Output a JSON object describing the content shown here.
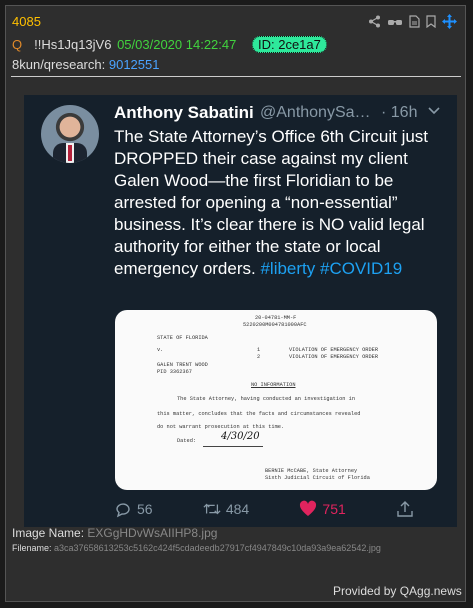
{
  "post": {
    "number": "4085",
    "tripcode_marker": "Q",
    "tripcode": "!!Hs1Jq13jV6",
    "date": "05/03/2020 14:22:47",
    "id_label": "ID: 2ce1a7",
    "board": "8kun/qresearch:",
    "board_link": "9012551"
  },
  "tweet": {
    "name": "Anthony Sabatini",
    "handle": "@AnthonySa…",
    "time": "· 16h",
    "text_main": "The State Attorney’s Office 6th Circuit just DROPPED their case against my client Galen Wood—the first Floridian to be arrested for opening a “non-essential” business.  It’s clear there is NO valid legal authority for either the state or local emergency orders.",
    "hashtag1": "#liberty",
    "hashtag2": "#COVID19",
    "replies": "56",
    "retweets": "484",
    "likes": "751"
  },
  "document": {
    "case_no": "20-04781-MM-F",
    "barcode_text": "5220200M004781000AFC",
    "state": "STATE OF FLORIDA",
    "vs": "v.",
    "count1_num": "1",
    "count1": "VIOLATION OF EMERGENCY ORDER",
    "count2_num": "2",
    "count2": "VIOLATION OF EMERGENCY ORDER",
    "defendant": "GALEN TRENT WOOD",
    "pid": "PID 3362367",
    "heading": "NO INFORMATION",
    "body1": "The State Attorney, having conducted an investigation in",
    "body2": "this matter, concludes that the facts and circumstances revealed",
    "body3": "do not warrant prosecution at this time.",
    "dated_label": "Dated:",
    "dated_value": "4/30/20",
    "sig1": "BERNIE McCABE, State Attorney",
    "sig2": "Sixth Judicial Circuit of Florida"
  },
  "image_info": {
    "name_label": "Image Name:",
    "name_value": "EXGgHDvWsAIIHP8.jpg",
    "filename_label": "Filename:",
    "filename_value": "a3ca37658613253c5162c424f5cdadeedb27917cf4947849c10da93a9ea62542.jpg"
  },
  "footer": {
    "provided_prefix": "Provided by",
    "provided_link": "QAgg.news"
  },
  "colors": {
    "accent_yellow": "#ffc000",
    "date_green": "#41d33e",
    "id_badge": "#2ee89b",
    "link_blue": "#4aa3ff",
    "twitter_blue": "#1da1f2",
    "like_red": "#e0245e"
  }
}
